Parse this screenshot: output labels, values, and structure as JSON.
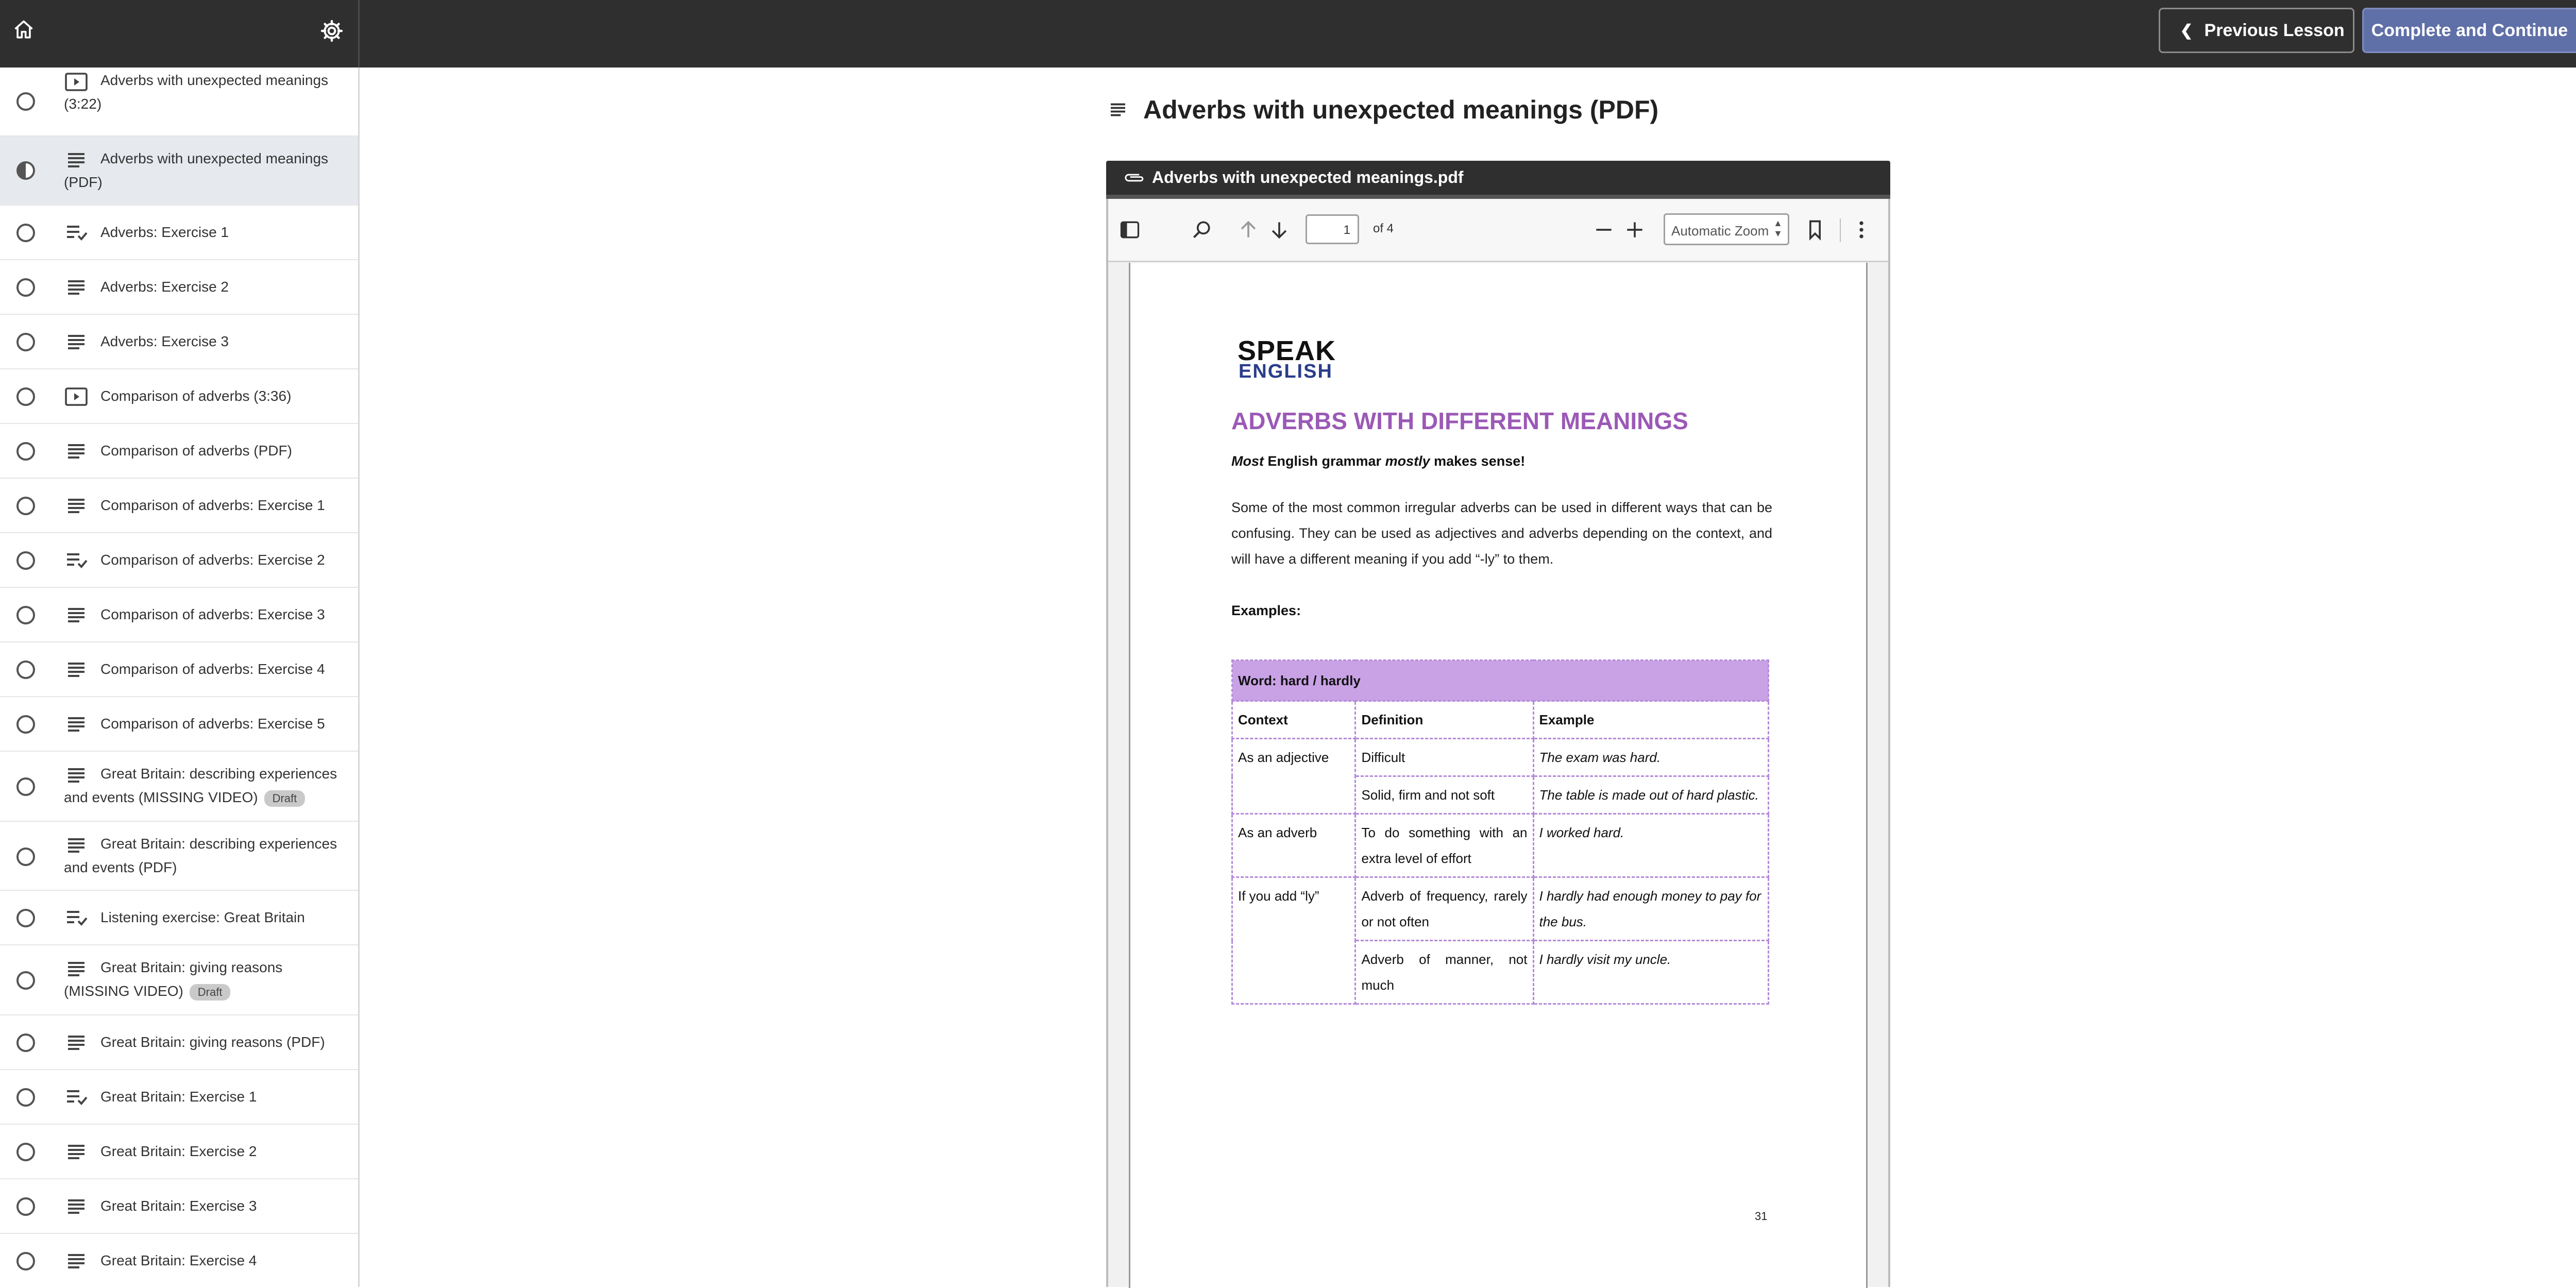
{
  "header": {
    "prev_label": "Previous Lesson",
    "next_label": "Complete and Continue"
  },
  "sidebar": {
    "items": [
      {
        "label": "Adverbs with unexpected meanings",
        "label_cont": "(3:22)",
        "icon": "video-icon",
        "status": "incomplete"
      },
      {
        "label": "Adverbs with unexpected meanings",
        "label_cont": "(PDF)",
        "icon": "text-icon",
        "status": "in-progress"
      },
      {
        "label": "Adverbs: Exercise 1",
        "icon": "quiz-icon",
        "status": "incomplete"
      },
      {
        "label": "Adverbs: Exercise 2",
        "icon": "text-icon",
        "status": "incomplete"
      },
      {
        "label": "Adverbs: Exercise 3",
        "icon": "text-icon",
        "status": "incomplete"
      },
      {
        "label": "Comparison of adverbs (3:36)",
        "icon": "video-icon",
        "status": "incomplete"
      },
      {
        "label": "Comparison of adverbs (PDF)",
        "icon": "text-icon",
        "status": "incomplete"
      },
      {
        "label": "Comparison of adverbs: Exercise 1",
        "icon": "text-icon",
        "status": "incomplete"
      },
      {
        "label": "Comparison of adverbs: Exercise 2",
        "icon": "quiz-icon",
        "status": "incomplete"
      },
      {
        "label": "Comparison of adverbs: Exercise 3",
        "icon": "text-icon",
        "status": "incomplete"
      },
      {
        "label": "Comparison of adverbs: Exercise 4",
        "icon": "text-icon",
        "status": "incomplete"
      },
      {
        "label": "Comparison of adverbs: Exercise 5",
        "icon": "text-icon",
        "status": "incomplete"
      },
      {
        "label": "Great Britain: describing experiences",
        "label_cont": "and events (MISSING VIDEO)",
        "badge": "Draft",
        "icon": "text-icon",
        "status": "incomplete"
      },
      {
        "label": "Great Britain: describing experiences",
        "label_cont": "and events (PDF)",
        "icon": "text-icon",
        "status": "incomplete"
      },
      {
        "label": "Listening exercise: Great Britain",
        "icon": "quiz-icon",
        "status": "incomplete"
      },
      {
        "label": "Great Britain: giving reasons",
        "label_cont": "(MISSING VIDEO)",
        "badge": "Draft",
        "icon": "text-icon",
        "status": "incomplete"
      },
      {
        "label": "Great Britain: giving reasons (PDF)",
        "icon": "text-icon",
        "status": "incomplete"
      },
      {
        "label": "Great Britain: Exercise 1",
        "icon": "quiz-icon",
        "status": "incomplete"
      },
      {
        "label": "Great Britain: Exercise 2",
        "icon": "text-icon",
        "status": "incomplete"
      },
      {
        "label": "Great Britain: Exercise 3",
        "icon": "text-icon",
        "status": "incomplete"
      },
      {
        "label": "Great Britain: Exercise 4",
        "icon": "text-icon",
        "status": "incomplete"
      }
    ]
  },
  "lesson": {
    "title": "Adverbs with unexpected meanings (PDF)",
    "attachment_name": "Adverbs with unexpected meanings.pdf"
  },
  "viewer": {
    "page_value": "1",
    "page_total": "of 4",
    "zoom": "Automatic Zoom"
  },
  "document": {
    "logo_line1": "SPEAK",
    "logo_line2": "ENGLISH",
    "heading": "ADVERBS WITH DIFFERENT MEANINGS",
    "intro_most": "Most",
    "intro_mid": " English grammar ",
    "intro_mostly": "mostly",
    "intro_end": " makes sense!",
    "body": "Some of the most common irregular adverbs can be used in different ways that can be confusing. They can be used as adjectives and adverbs depending on the context, and will have a different meaning if you add “-ly” to them.",
    "examples_label": "Examples:",
    "table": {
      "word_header": "Word: hard / hardly",
      "col_context": "Context",
      "col_definition": "Definition",
      "col_example": "Example",
      "r1_context": "As an adjective",
      "r1_def": "Difficult",
      "r1_ex": "The exam was hard.",
      "r2_def": "Solid, firm and not soft",
      "r2_ex": "The table is made out of hard plastic.",
      "r3_context": "As an adverb",
      "r3_def": "To do something with an extra level of effort",
      "r3_ex": "I worked hard.",
      "r4_context": "If you add “ly”",
      "r4_def": "Adverb of frequency, rarely or not often",
      "r4_ex": "I hardly had enough money to pay for the bus.",
      "r5_def": "Adverb of manner, not much",
      "r5_ex": "I hardly visit my uncle."
    },
    "page_number": "31"
  }
}
